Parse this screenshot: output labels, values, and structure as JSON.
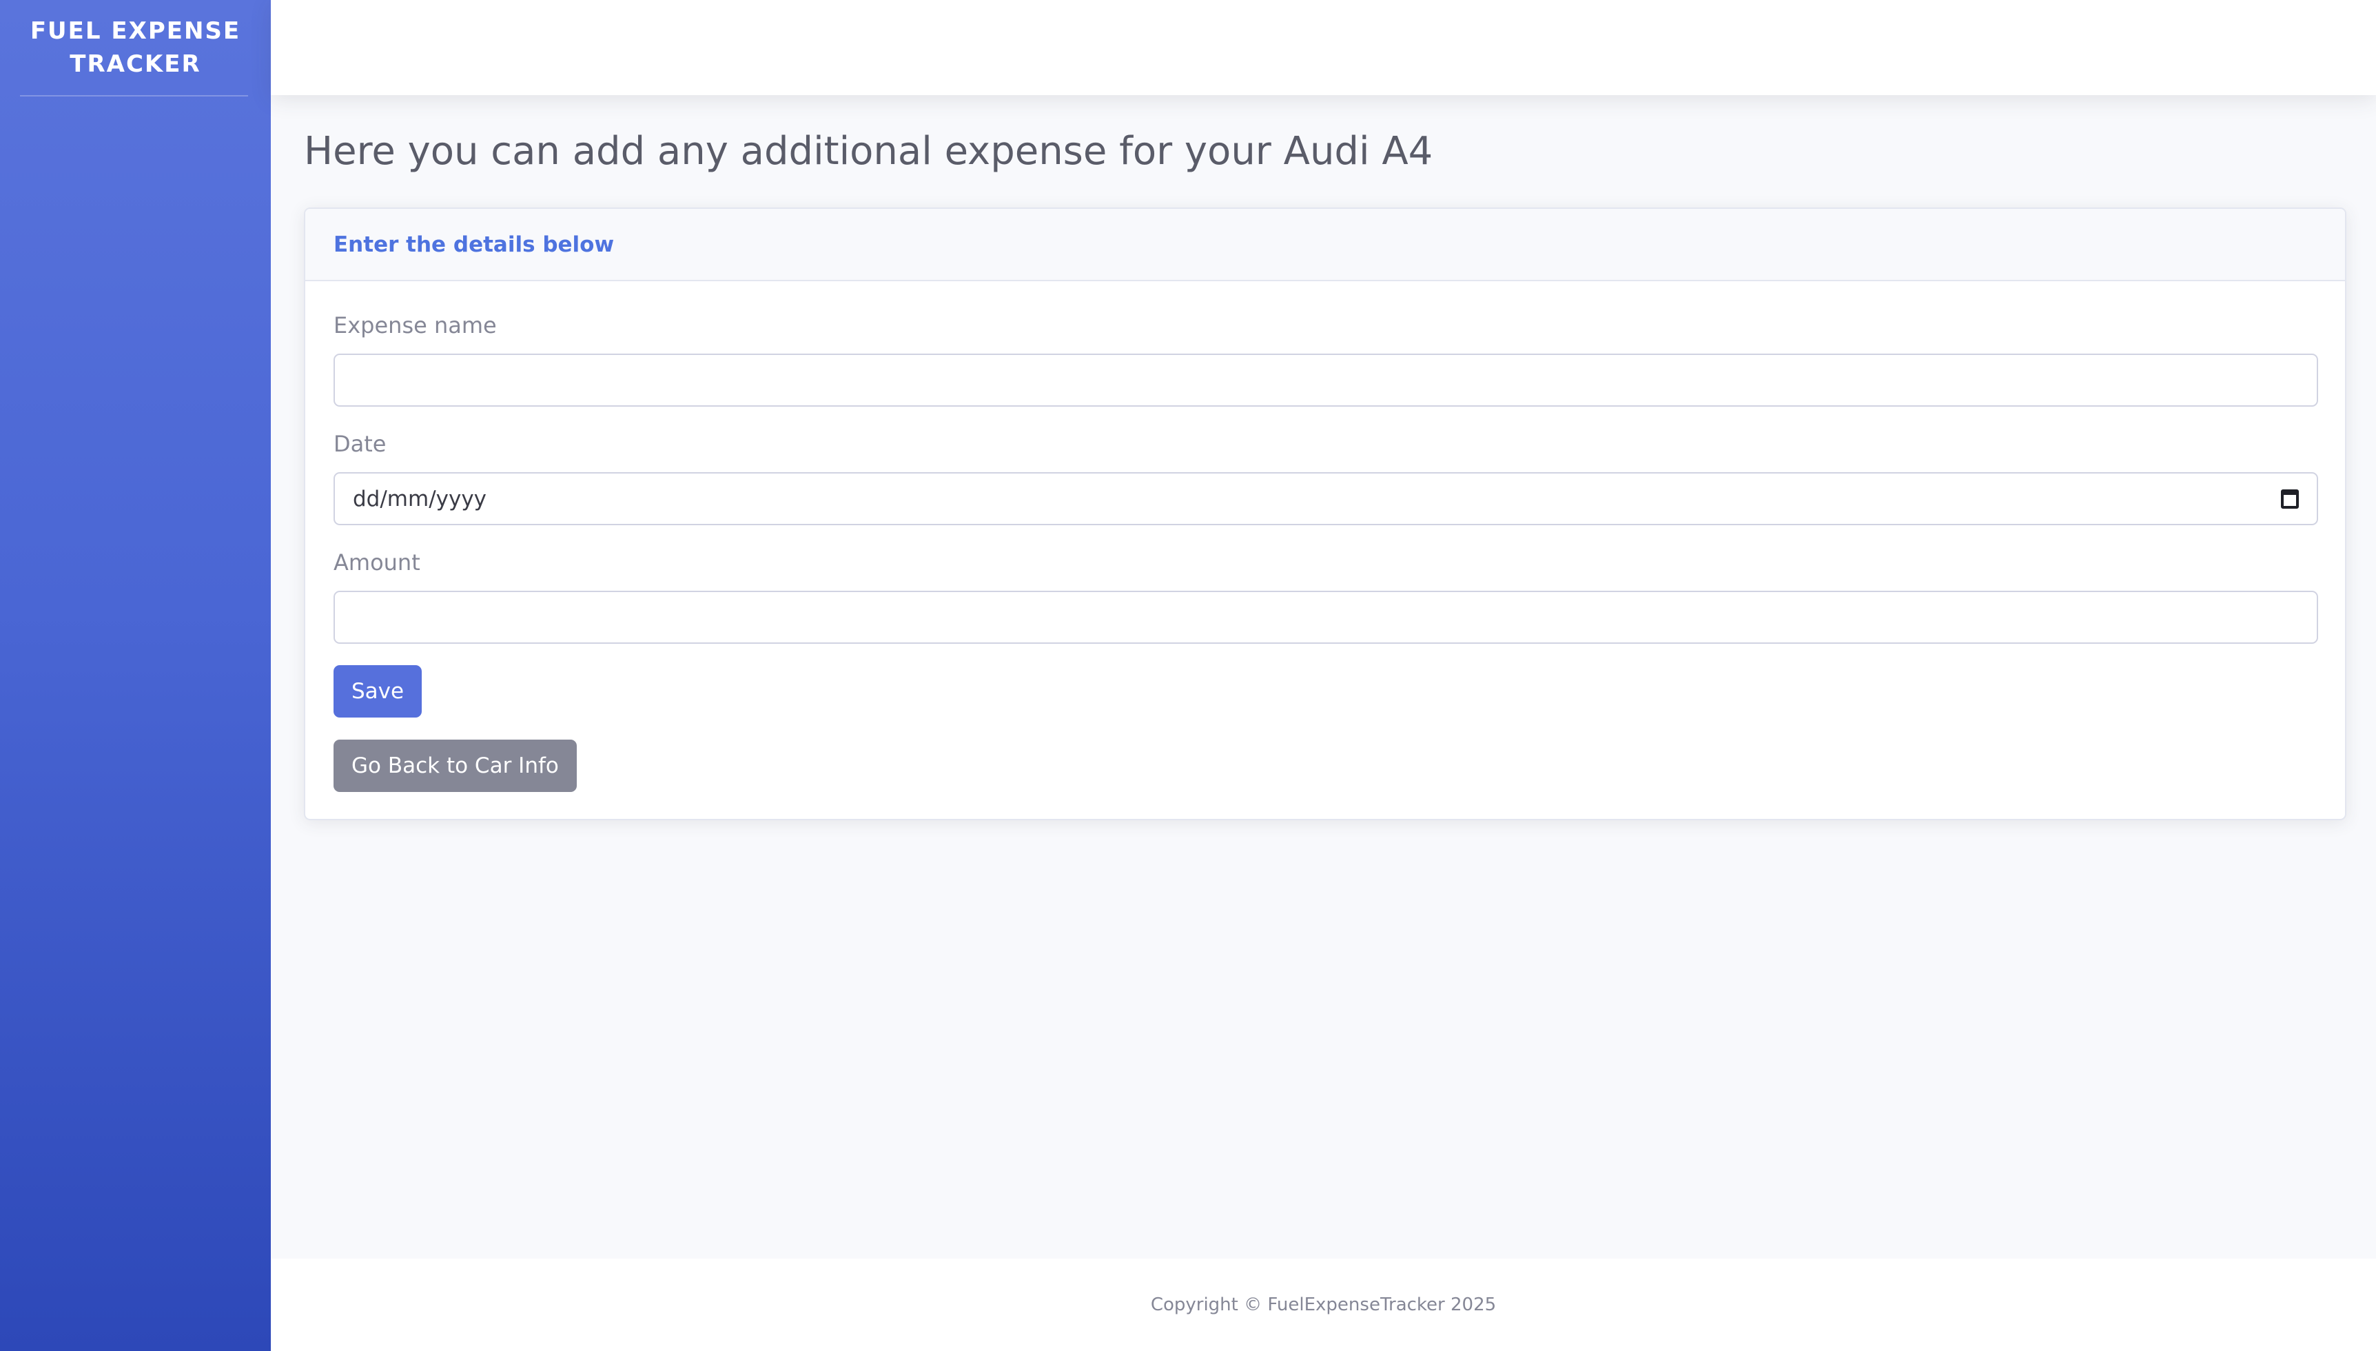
{
  "sidebar": {
    "brand": "FUEL EXPENSE TRACKER"
  },
  "main": {
    "title": "Here you can add any additional expense for your Audi A4",
    "card": {
      "header": "Enter the details below",
      "fields": {
        "expense_name": {
          "label": "Expense name",
          "value": ""
        },
        "date": {
          "label": "Date",
          "placeholder": "dd/mm/yyyy"
        },
        "amount": {
          "label": "Amount",
          "value": ""
        }
      },
      "save_label": "Save",
      "back_label": "Go Back to Car Info"
    }
  },
  "footer": {
    "copyright": "Copyright © FuelExpenseTracker 2025"
  },
  "colors": {
    "primary": "#4e73df",
    "secondary": "#858796",
    "sidebar_top": "#5a74dc",
    "sidebar_bottom": "#2d48b8"
  },
  "icons": {
    "date_picker": "calendar-icon"
  }
}
